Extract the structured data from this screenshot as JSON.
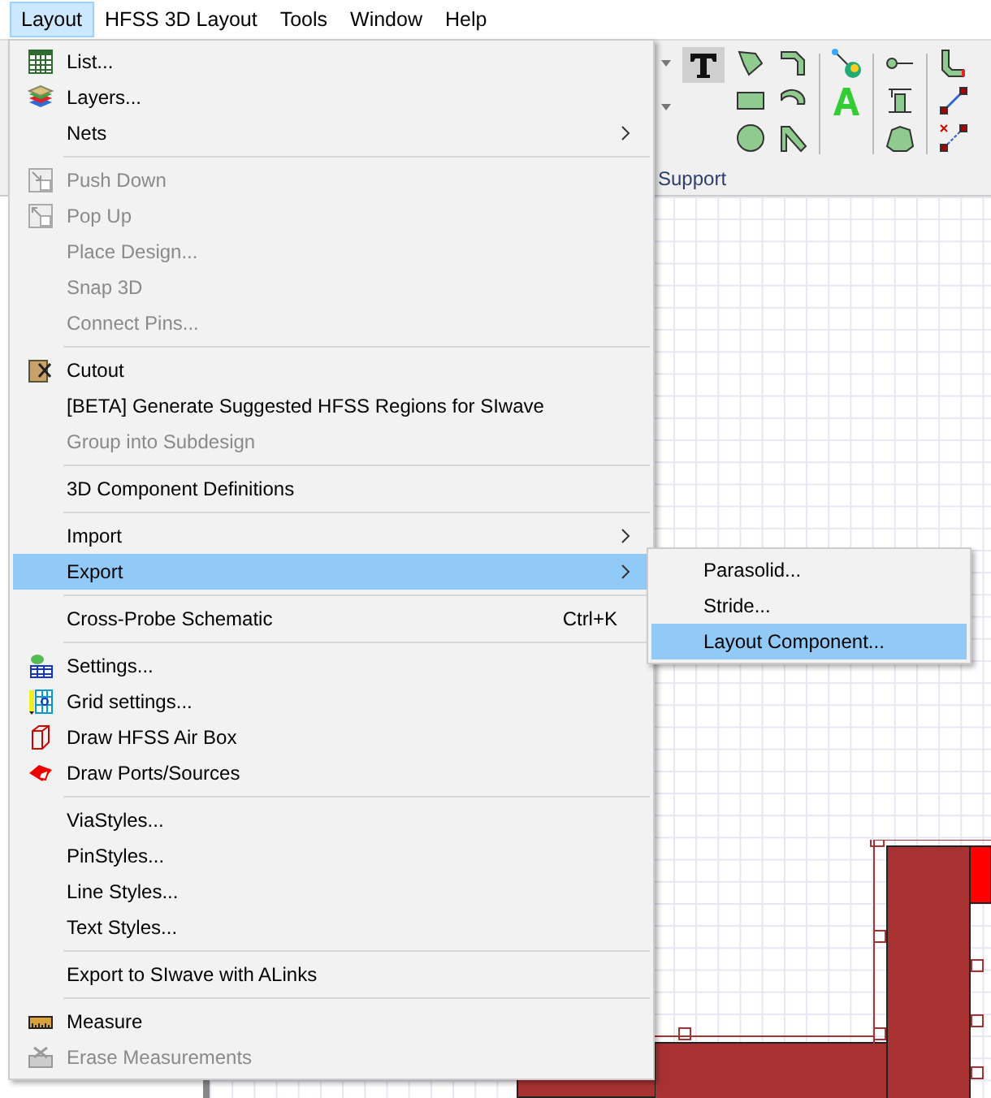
{
  "menubar": [
    {
      "label": "Layout",
      "selected": true
    },
    {
      "label": "HFSS 3D Layout",
      "selected": false
    },
    {
      "label": "Tools",
      "selected": false
    },
    {
      "label": "Window",
      "selected": false
    },
    {
      "label": "Help",
      "selected": false
    }
  ],
  "toolbar": {
    "group_label": "Support"
  },
  "menu": {
    "groups": [
      [
        {
          "label": "List...",
          "disabled": false,
          "selected": false
        },
        {
          "label": "Layers...",
          "disabled": false,
          "selected": false
        },
        {
          "label": "Nets",
          "disabled": false,
          "selected": false,
          "submenu": true
        }
      ],
      [
        {
          "label": "Push Down",
          "disabled": true,
          "selected": false
        },
        {
          "label": "Pop Up",
          "disabled": true,
          "selected": false
        },
        {
          "label": "Place Design...",
          "disabled": true,
          "selected": false
        },
        {
          "label": "Snap 3D",
          "disabled": true,
          "selected": false
        },
        {
          "label": "Connect Pins...",
          "disabled": true,
          "selected": false
        }
      ],
      [
        {
          "label": "Cutout",
          "disabled": false,
          "selected": false
        },
        {
          "label": "[BETA] Generate Suggested HFSS Regions for SIwave",
          "disabled": false,
          "selected": false
        },
        {
          "label": "Group into Subdesign",
          "disabled": true,
          "selected": false
        }
      ],
      [
        {
          "label": "3D Component Definitions",
          "disabled": false,
          "selected": false
        }
      ],
      [
        {
          "label": "Import",
          "disabled": false,
          "selected": false,
          "submenu": true
        },
        {
          "label": "Export",
          "disabled": false,
          "selected": true,
          "submenu": true
        }
      ],
      [
        {
          "label": "Cross-Probe Schematic",
          "disabled": false,
          "selected": false,
          "shortcut": "Ctrl+K"
        }
      ],
      [
        {
          "label": "Settings...",
          "disabled": false,
          "selected": false
        },
        {
          "label": "Grid settings...",
          "disabled": false,
          "selected": false
        },
        {
          "label": "Draw HFSS Air Box",
          "disabled": false,
          "selected": false
        },
        {
          "label": "Draw Ports/Sources",
          "disabled": false,
          "selected": false
        }
      ],
      [
        {
          "label": "ViaStyles...",
          "disabled": false,
          "selected": false
        },
        {
          "label": "PinStyles...",
          "disabled": false,
          "selected": false
        },
        {
          "label": "Line Styles...",
          "disabled": false,
          "selected": false
        },
        {
          "label": "Text Styles...",
          "disabled": false,
          "selected": false
        }
      ],
      [
        {
          "label": "Export to SIwave with ALinks",
          "disabled": false,
          "selected": false
        }
      ],
      [
        {
          "label": "Measure",
          "disabled": false,
          "selected": false
        },
        {
          "label": "Erase Measurements",
          "disabled": true,
          "selected": false
        }
      ]
    ]
  },
  "submenu": {
    "items": [
      {
        "label": "Parasolid...",
        "selected": false
      },
      {
        "label": "Stride...",
        "selected": false
      },
      {
        "label": "Layout Component...",
        "selected": true
      }
    ]
  }
}
